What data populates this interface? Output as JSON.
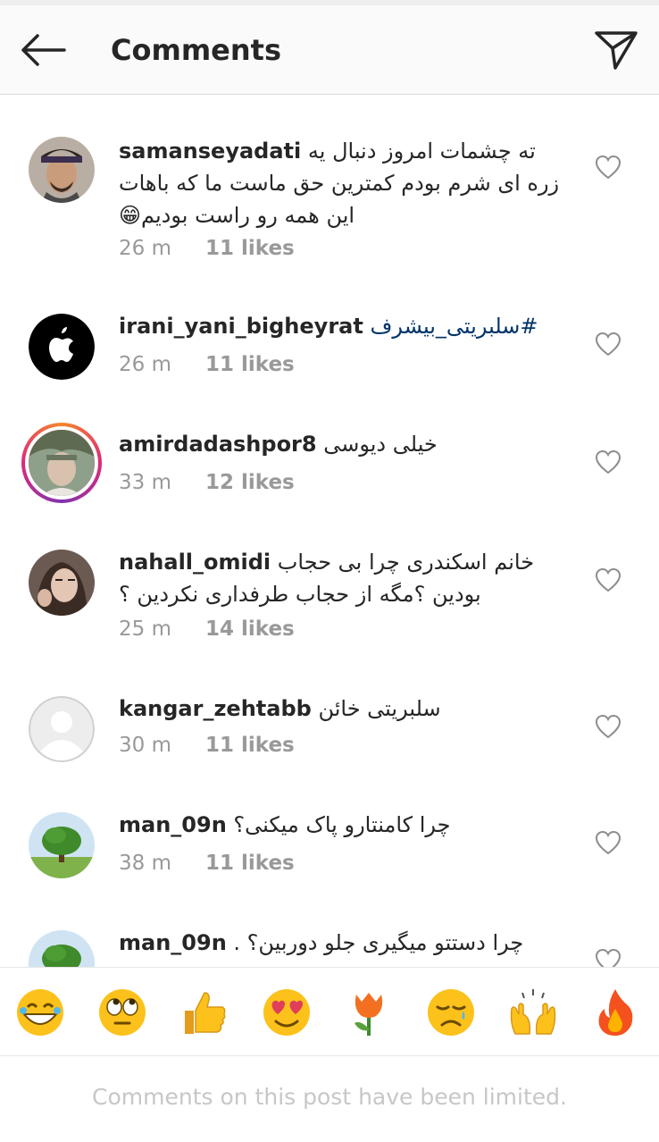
{
  "header": {
    "title": "Comments",
    "back_icon": "arrow-left-icon",
    "share_icon": "paper-plane-icon"
  },
  "comments": [
    {
      "username": "samanseyadati",
      "text": "ته چشمات امروز دنبال یه زره ای شرم بودم کمترین حق ماست ما که باهات این همه رو راست بودیم😁",
      "time": "26 m",
      "likes": "11 likes"
    },
    {
      "username": "irani_yani_bigheyrat",
      "hashtag": "#سلبریتی_بیشرف",
      "time": "26 m",
      "likes": "11 likes"
    },
    {
      "username": "amirdadashpor8",
      "text": "خیلی دیوسی",
      "time": "33 m",
      "likes": "12 likes"
    },
    {
      "username": "nahall_omidi",
      "text": "خانم اسکندری چرا بی حجاب بودین ؟مگه از حجاب طرفداری نکردین ؟",
      "time": "25 m",
      "likes": "14 likes"
    },
    {
      "username": "kangar_zehtabb",
      "text": "سلبریتی خائن",
      "time": "30 m",
      "likes": "11 likes"
    },
    {
      "username": "man_09n",
      "text": "چرا کامنتارو پاک میکنی؟",
      "time": "38 m",
      "likes": "11 likes"
    },
    {
      "username": "man_09n",
      "text": "چرا دستتو میگیری جلو دوربین؟ ."
    }
  ],
  "emoji_bar": [
    "grinning-face-emoji",
    "rolling-eyes-emoji",
    "thumbs-up-emoji",
    "heart-eyes-emoji",
    "tulip-emoji",
    "sad-face-emoji",
    "raised-hands-emoji",
    "fire-emoji"
  ],
  "footer": {
    "text": "Comments on this post have been limited."
  },
  "colors": {
    "text": "#262626",
    "meta": "#999999",
    "hashtag": "#003569",
    "footer": "#c7c7c7"
  }
}
